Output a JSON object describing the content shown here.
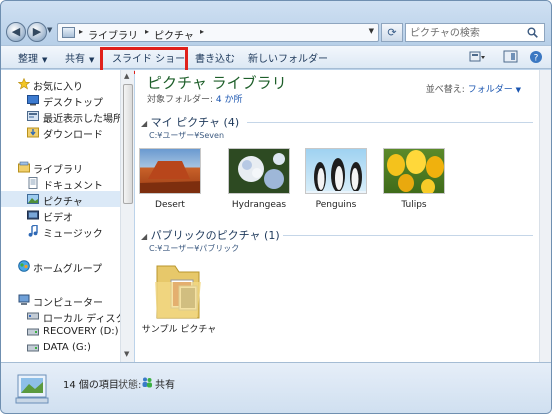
{
  "address": {
    "crumbs": [
      "ライブラリ",
      "ピクチャ"
    ],
    "search_placeholder": "ピクチャの検索"
  },
  "toolbar": {
    "organize": "整理",
    "share": "共有",
    "slideshow": "スライド ショー",
    "burn": "書き込む",
    "new_folder": "新しいフォルダー"
  },
  "nav": {
    "favorites": "お気に入り",
    "desktop": "デスクトップ",
    "recent": "最近表示した場所",
    "downloads": "ダウンロード",
    "libraries": "ライブラリ",
    "documents": "ドキュメント",
    "pictures": "ピクチャ",
    "videos": "ビデオ",
    "music": "ミュージック",
    "homegroup": "ホームグループ",
    "computer": "コンピューター",
    "local_disk": "ローカル ディスク (C",
    "recovery": "RECOVERY (D:)",
    "data": "DATA (G:)"
  },
  "main": {
    "library_title": "ピクチャ ライブラリ",
    "target_label": "対象フォルダー:",
    "target_value": "4 か所",
    "arrange_label": "並べ替え:",
    "arrange_value": "フォルダー",
    "group1": {
      "title": "マイ ピクチャ (4)",
      "path": "C:¥ユーザー¥Seven",
      "items": [
        "Desert",
        "Hydrangeas",
        "Penguins",
        "Tulips"
      ]
    },
    "group2": {
      "title": "パブリックのピクチャ (1)",
      "path": "C:¥ユーザー¥パブリック",
      "items": [
        "サンプル ピクチャ"
      ]
    }
  },
  "details": {
    "count": "14 個の項目",
    "status_label": "状態:",
    "status_value": "共有"
  }
}
